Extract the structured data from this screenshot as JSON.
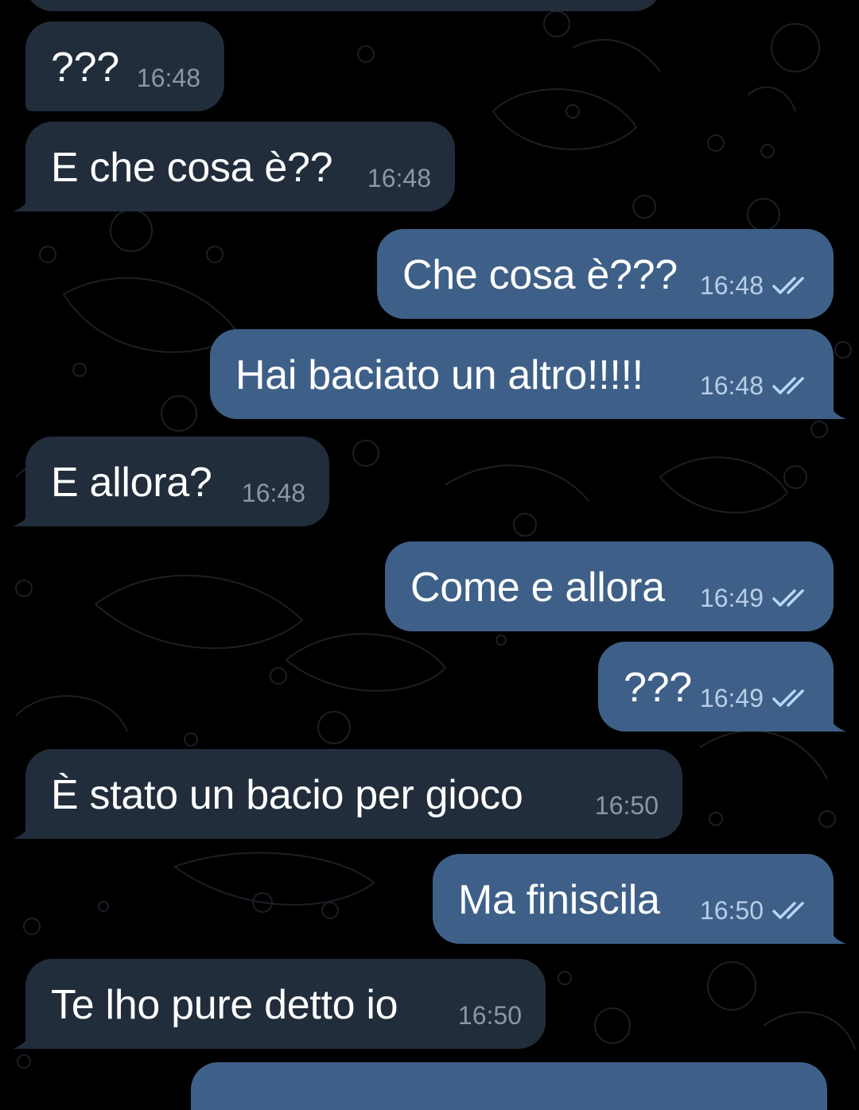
{
  "chat": {
    "messages": [
      {
        "direction": "in",
        "text": "???",
        "time": "16:48"
      },
      {
        "direction": "in",
        "text": "E che cosa è??",
        "time": "16:48"
      },
      {
        "direction": "out",
        "text": "Che cosa è???",
        "time": "16:48",
        "status": "read"
      },
      {
        "direction": "out",
        "text": "Hai baciato un altro!!!!!",
        "time": "16:48",
        "status": "read"
      },
      {
        "direction": "in",
        "text": "E allora?",
        "time": "16:48"
      },
      {
        "direction": "out",
        "text": "Come e allora",
        "time": "16:49",
        "status": "read"
      },
      {
        "direction": "out",
        "text": "???",
        "time": "16:49",
        "status": "read"
      },
      {
        "direction": "in",
        "text": "È stato un bacio per gioco",
        "time": "16:50"
      },
      {
        "direction": "out",
        "text": "Ma finiscila",
        "time": "16:50",
        "status": "read"
      },
      {
        "direction": "in",
        "text": "Te lho pure detto io",
        "time": "16:50"
      }
    ]
  },
  "colors": {
    "background": "#000000",
    "incoming_bubble": "#212d3b",
    "outgoing_bubble": "#3e6088",
    "incoming_time": "#8a97a6",
    "outgoing_time": "#b8cde6",
    "read_check": "#b8d6f5"
  },
  "icons": {
    "read_status": "double-check-icon"
  }
}
